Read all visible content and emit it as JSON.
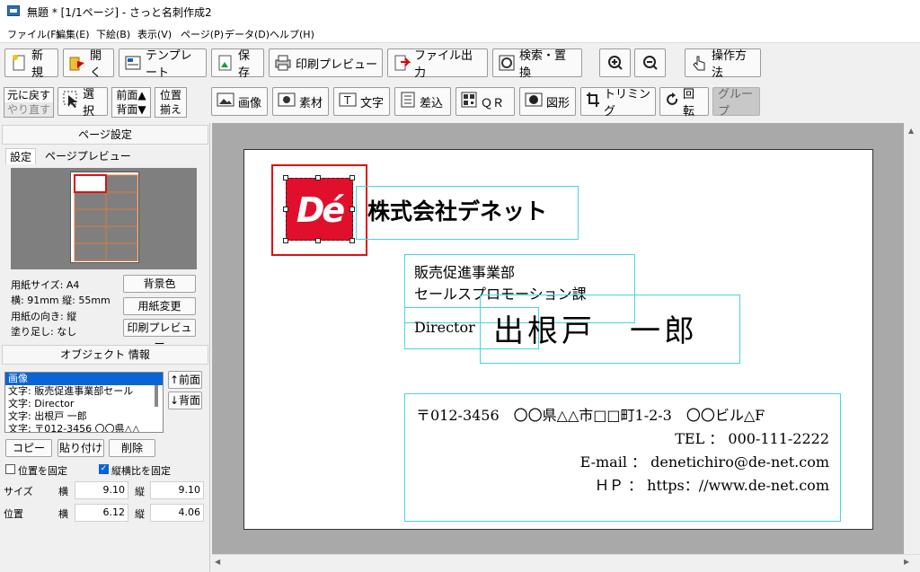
{
  "window": {
    "title": "無題 * [1/1ページ] - さっと名刺作成2"
  },
  "menu": [
    "ファイル(F)",
    "編集(E)",
    "下絵(B)",
    "表示(V)",
    "ページ(P)",
    "データ(D)",
    "ヘルプ(H)"
  ],
  "toolbar1": {
    "new": "新規",
    "open": "開く",
    "template": "テンプレート",
    "save": "保存",
    "print_preview": "印刷プレビュー",
    "file_output": "ファイル出力",
    "search_replace": "検索・置換",
    "how_to": "操作方法"
  },
  "toolbar2": {
    "undo": "元に戻す",
    "redo": "やり直す",
    "select": "選択",
    "front": "前面▲",
    "back": "背面▼",
    "align1": "位置",
    "align2": "揃え",
    "image": "画像",
    "material": "素材",
    "text": "文字",
    "insert": "差込",
    "qr": "ＱＲ",
    "shape": "図形",
    "trimming": "トリミング",
    "rotate": "回転",
    "group": "グループ"
  },
  "page_settings": {
    "header": "ページ設定",
    "tab_settings": "設定",
    "tab_preview": "ページプレビュー",
    "paper_size": "用紙サイズ: A4",
    "dimensions": "横: 91mm  縦: 55mm",
    "orientation": "用紙の向き: 縦",
    "bleed": "塗り足し: なし",
    "bg_color": "背景色",
    "change_paper": "用紙変更",
    "print_preview": "印刷プレビュー"
  },
  "object_info": {
    "header": "オブジェクト 情報",
    "items": [
      "画像",
      "文字: 販売促進事業部セール",
      "文字: Director",
      "文字: 出根戸 一郎",
      "文字: 〒012-3456 〇〇県△△"
    ],
    "front": "前面",
    "back": "背面",
    "copy": "コピー",
    "paste": "貼り付け",
    "delete": "削除",
    "lock_position": "位置を固定",
    "lock_aspect": "縦横比を固定",
    "size_label": "サイズ",
    "pos_label": "位置",
    "w_label": "横",
    "h_label": "縦",
    "size_w": "9.10",
    "size_h": "9.10",
    "pos_x": "6.12",
    "pos_y": "4.06"
  },
  "card": {
    "logo_text": "Dé",
    "company": "株式会社デネット",
    "dept1": "販売促進事業部",
    "dept2": "セールスプロモーション課",
    "title": "Director",
    "name": "出根戸　一郎",
    "address": "〒012-3456　〇〇県△△市□□町1-2-3　〇〇ビル△F",
    "tel": "TEL ： 000-111-2222",
    "email": "E-mail ： denetichiro@de-net.com",
    "hp": "ＨＰ ： https：//www.de-net.com"
  },
  "colors": {
    "logo_red": "#e0102c",
    "selection_red": "#e01010",
    "guide_cyan": "#46d5e0"
  }
}
